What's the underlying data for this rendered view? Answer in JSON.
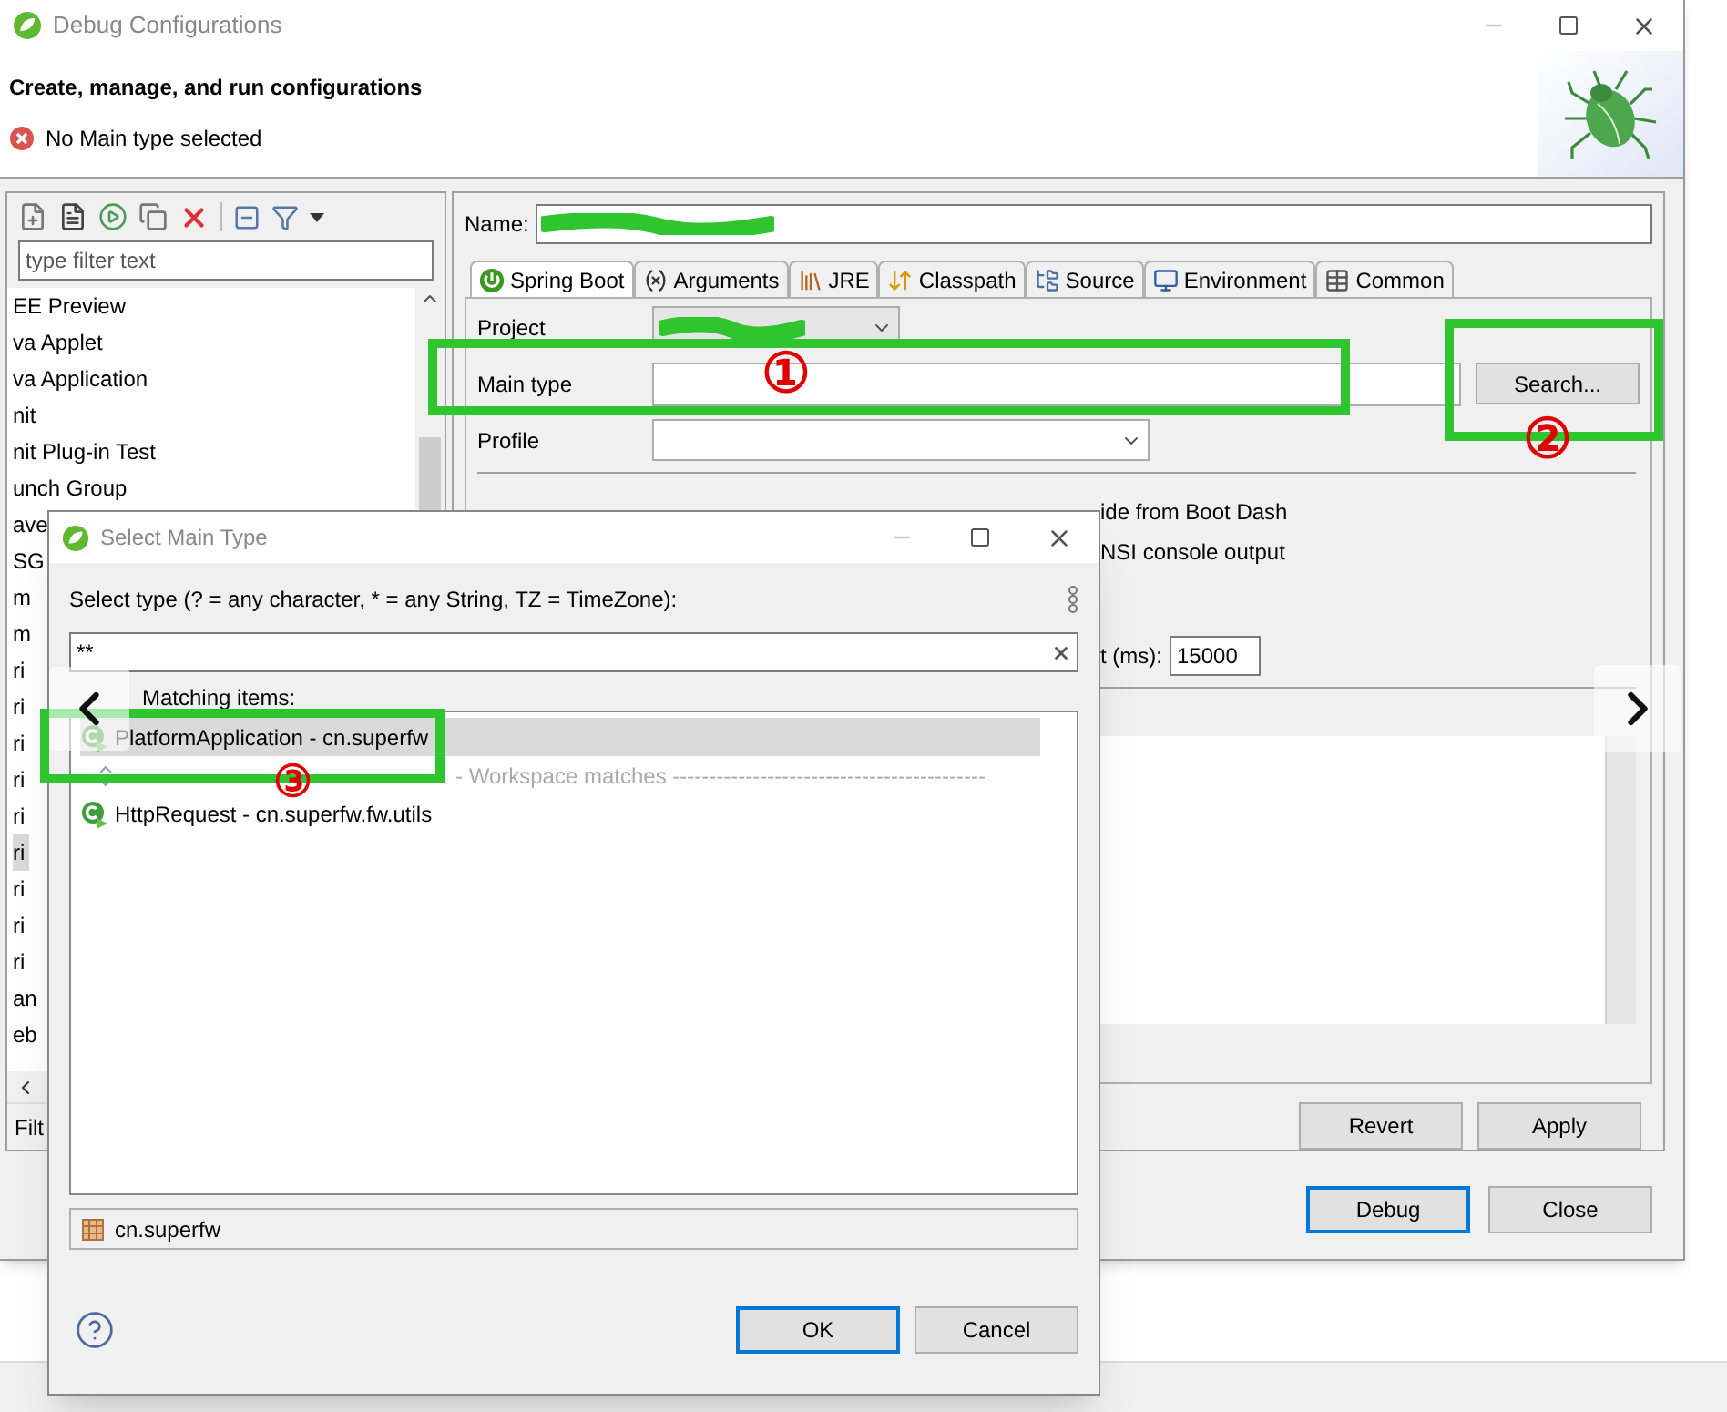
{
  "window": {
    "title": "Debug Configurations"
  },
  "header": {
    "title": "Create, manage, and run configurations",
    "message": "No Main type selected"
  },
  "sidebar": {
    "filter_placeholder": "type filter text",
    "items": [
      {
        "label": "EE Preview",
        "selected": false
      },
      {
        "label": "va Applet",
        "selected": false
      },
      {
        "label": "va Application",
        "selected": false
      },
      {
        "label": "nit",
        "selected": false
      },
      {
        "label": "nit Plug-in Test",
        "selected": false
      },
      {
        "label": "unch Group",
        "selected": false
      },
      {
        "label": "ave",
        "selected": false
      },
      {
        "label": "SG",
        "selected": false
      },
      {
        "label": "m",
        "selected": false
      },
      {
        "label": "m",
        "selected": false
      },
      {
        "label": "ri",
        "selected": false
      },
      {
        "label": "ri",
        "selected": false
      },
      {
        "label": "ri",
        "selected": false
      },
      {
        "label": "ri",
        "selected": false
      },
      {
        "label": "ri",
        "selected": false
      },
      {
        "label": "ri",
        "selected": true
      },
      {
        "label": "ri",
        "selected": false
      },
      {
        "label": "ri",
        "selected": false
      },
      {
        "label": "ri",
        "selected": false
      },
      {
        "label": "an",
        "selected": false
      },
      {
        "label": "eb",
        "selected": false
      }
    ],
    "footer": "Filt"
  },
  "editor": {
    "name_label": "Name:",
    "name_redacted": true,
    "tabs": [
      {
        "label": "Spring Boot",
        "selected": true
      },
      {
        "label": "Arguments",
        "selected": false
      },
      {
        "label": "JRE",
        "selected": false
      },
      {
        "label": "Classpath",
        "selected": false
      },
      {
        "label": "Source",
        "selected": false
      },
      {
        "label": "Environment",
        "selected": false
      },
      {
        "label": "Common",
        "selected": false
      }
    ],
    "fields": [
      {
        "label": "Project",
        "kind": "combo",
        "redacted": true
      },
      {
        "label": "Main type",
        "kind": "text",
        "redacted": false
      },
      {
        "label": "Profile",
        "kind": "combo",
        "redacted": false
      }
    ],
    "search_button": "Search...",
    "options": [
      "ide from Boot Dash",
      "NSI console output"
    ],
    "timeout": {
      "label": "t (ms):",
      "value": "15000"
    },
    "buttons": [
      "Revert",
      "Apply"
    ]
  },
  "footer_buttons": [
    {
      "label": "Debug",
      "default": true
    },
    {
      "label": "Close",
      "default": false
    }
  ],
  "dialog": {
    "title": "Select Main Type",
    "prompt": "Select type (? = any character, * = any String, TZ = TimeZone):",
    "filter": "**",
    "list_label": "Matching items:",
    "items": [
      {
        "kind": "type",
        "label": "PlatformApplication - cn.superfw",
        "selected": true
      },
      {
        "kind": "separator",
        "label": "- Workspace matches -------------------------------------------",
        "selected": false
      },
      {
        "kind": "type",
        "label": "HttpRequest - cn.superfw.fw.utils",
        "selected": false
      }
    ],
    "package": "cn.superfw",
    "buttons": [
      {
        "label": "OK",
        "default": true
      },
      {
        "label": "Cancel",
        "default": false
      }
    ]
  },
  "annotations": [
    {
      "label": "①"
    },
    {
      "label": "②"
    },
    {
      "label": "③"
    }
  ]
}
